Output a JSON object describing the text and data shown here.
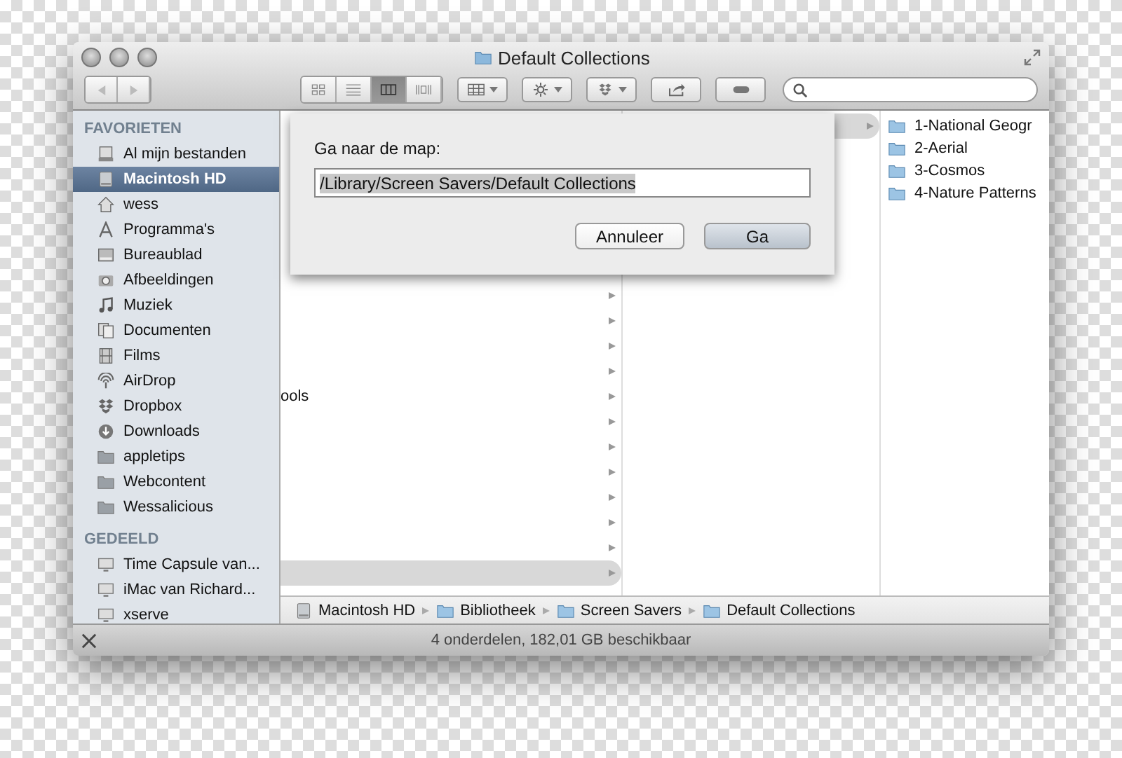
{
  "window": {
    "title": "Default Collections"
  },
  "toolbar": {
    "view_buttons": [
      {
        "kind": "icons",
        "selected": false
      },
      {
        "kind": "list",
        "selected": false
      },
      {
        "kind": "columns",
        "selected": true
      },
      {
        "kind": "coverflow",
        "selected": false
      }
    ]
  },
  "sidebar": {
    "sections": [
      {
        "title": "FAVORIETEN",
        "items": [
          {
            "label": "Al mijn bestanden",
            "kind": "files",
            "selected": false
          },
          {
            "label": "Macintosh HD",
            "kind": "drive",
            "selected": true
          },
          {
            "label": "wess",
            "kind": "home",
            "selected": false
          },
          {
            "label": "Programma's",
            "kind": "apps",
            "selected": false
          },
          {
            "label": "Bureaublad",
            "kind": "desktop",
            "selected": false
          },
          {
            "label": "Afbeeldingen",
            "kind": "camera",
            "selected": false
          },
          {
            "label": "Muziek",
            "kind": "music",
            "selected": false
          },
          {
            "label": "Documenten",
            "kind": "docs",
            "selected": false
          },
          {
            "label": "Films",
            "kind": "film",
            "selected": false
          },
          {
            "label": "AirDrop",
            "kind": "airdrop",
            "selected": false
          },
          {
            "label": "Dropbox",
            "kind": "dropbox",
            "selected": false
          },
          {
            "label": "Downloads",
            "kind": "download",
            "selected": false
          },
          {
            "label": "appletips",
            "kind": "folder",
            "selected": false
          },
          {
            "label": "Webcontent",
            "kind": "folder",
            "selected": false
          },
          {
            "label": "Wessalicious",
            "kind": "folder",
            "selected": false
          }
        ]
      },
      {
        "title": "GEDEELD",
        "items": [
          {
            "label": "Time Capsule van...",
            "kind": "display",
            "selected": false
          },
          {
            "label": "iMac van Richard...",
            "kind": "display",
            "selected": false
          },
          {
            "label": "xserve",
            "kind": "display",
            "selected": false
          }
        ]
      }
    ]
  },
  "column_1": {
    "visible_text": "ools"
  },
  "column_3": {
    "items": [
      {
        "label": "1-National Geogr"
      },
      {
        "label": "2-Aerial"
      },
      {
        "label": "3-Cosmos"
      },
      {
        "label": "4-Nature Patterns"
      }
    ]
  },
  "sheet": {
    "label": "Ga naar de map:",
    "value": "/Library/Screen Savers/Default Collections",
    "buttons": [
      {
        "label": "Annuleer",
        "default": false
      },
      {
        "label": "Ga",
        "default": true
      }
    ]
  },
  "path_bar": [
    {
      "label": "Macintosh HD",
      "kind": "drive"
    },
    {
      "label": "Bibliotheek",
      "kind": "folder"
    },
    {
      "label": "Screen Savers",
      "kind": "folder"
    },
    {
      "label": "Default Collections",
      "kind": "folder"
    }
  ],
  "status_bar": "4 onderdelen, 182,01 GB beschikbaar"
}
